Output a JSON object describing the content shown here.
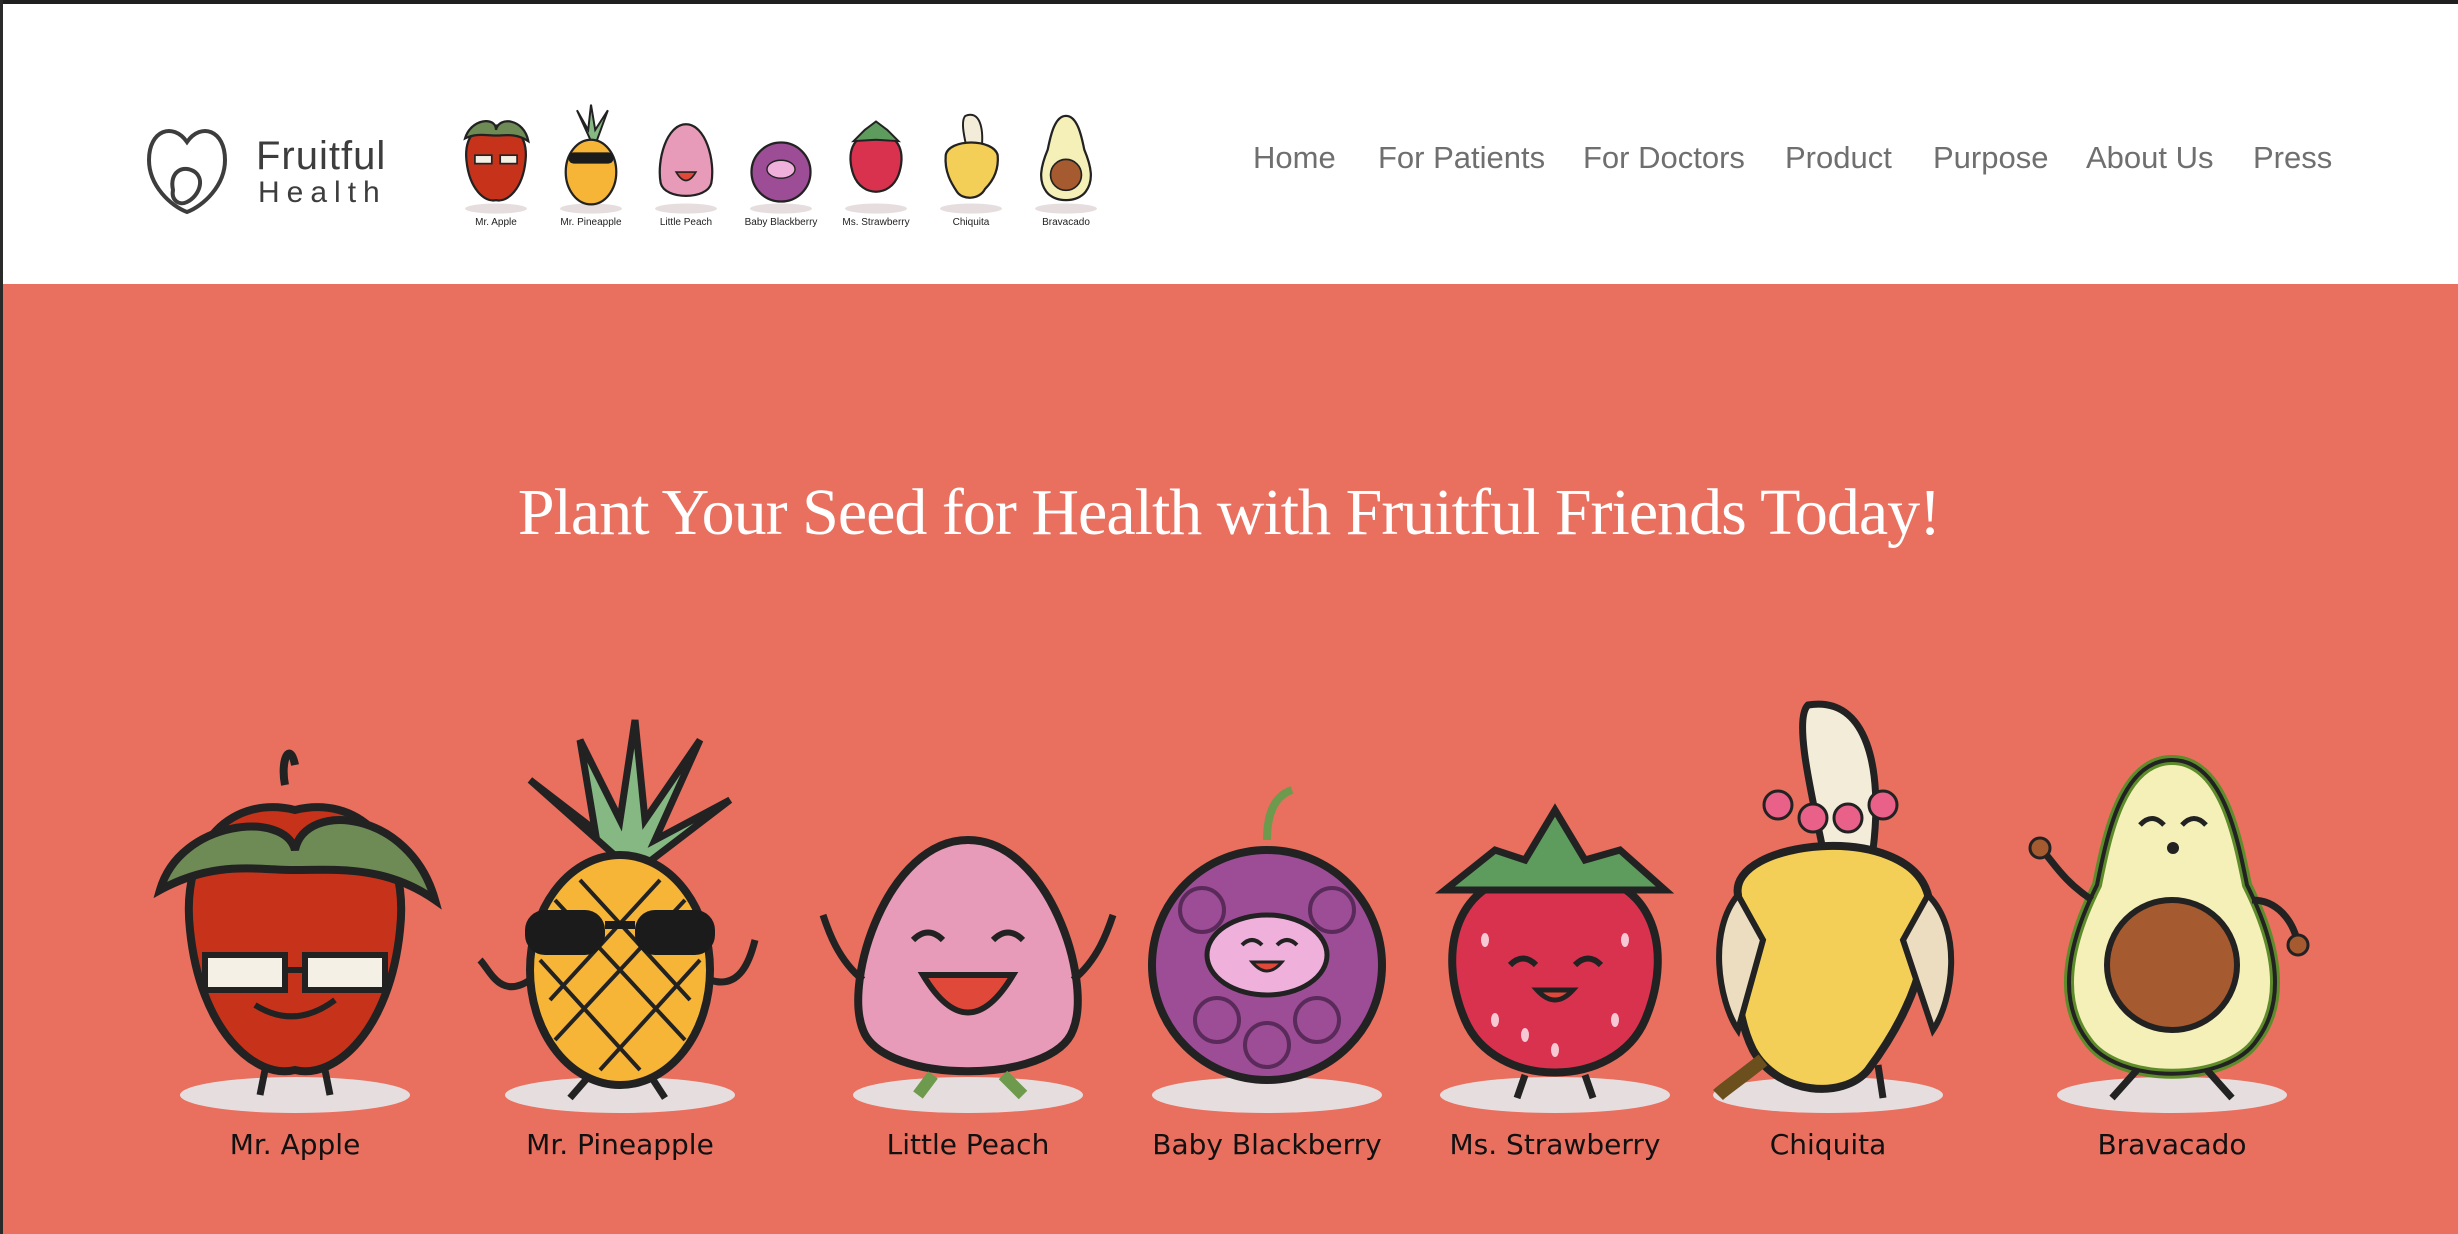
{
  "brand": {
    "name_line1": "Fruitful",
    "name_line2": "Health"
  },
  "nav": {
    "items": [
      "Home",
      "For Patients",
      "For Doctors",
      "Product",
      "Purpose",
      "About Us",
      "Press"
    ]
  },
  "hero": {
    "title": "Plant Your Seed for Health with Fruitful Friends Today!"
  },
  "characters": [
    {
      "name": "Mr. Apple",
      "icon": "apple-character-icon"
    },
    {
      "name": "Mr. Pineapple",
      "icon": "pineapple-character-icon"
    },
    {
      "name": "Little Peach",
      "icon": "peach-character-icon"
    },
    {
      "name": "Baby Blackberry",
      "icon": "blackberry-character-icon"
    },
    {
      "name": "Ms. Strawberry",
      "icon": "strawberry-character-icon"
    },
    {
      "name": "Chiquita",
      "icon": "banana-character-icon"
    },
    {
      "name": "Bravacado",
      "icon": "avocado-character-icon"
    }
  ],
  "colors": {
    "hero_bg": "#e96f5f",
    "header_bg": "#ffffff",
    "nav_text": "#6f6f6f"
  }
}
